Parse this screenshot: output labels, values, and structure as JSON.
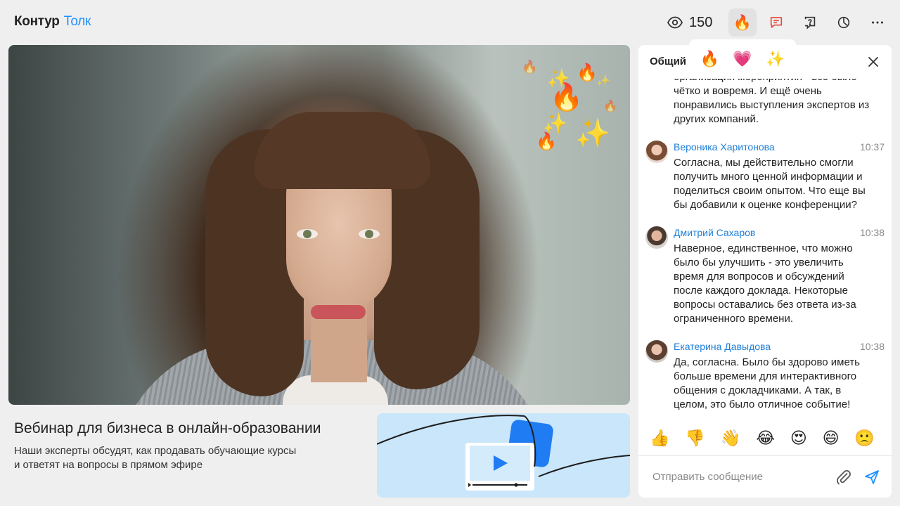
{
  "header": {
    "brand": "Контур",
    "product": "Толк",
    "viewers_count": "150"
  },
  "toolbar": {
    "reaction_icon": "fire-emoji",
    "chat_icon": "chat-icon",
    "question_icon": "question-icon",
    "poll_icon": "pie-chart-icon",
    "more_icon": "more-dots-icon"
  },
  "reaction_popup": [
    "🔥",
    "💗",
    "✨"
  ],
  "webinar": {
    "title": "Вебинар для бизнеса в онлайн-образовании",
    "description_line1": "Наши эксперты обсудят, как продавать обучающие курсы",
    "description_line2": "и ответят на вопросы в прямом эфире"
  },
  "chat": {
    "tab_label": "Общий",
    "continued_lines": [
      "организация мероприятия - всё было",
      "чётко и вовремя. И ещё очень",
      "понравились выступления экспертов из",
      "других компаний."
    ],
    "messages": [
      {
        "author": "Вероника Харитонова",
        "time": "10:37",
        "lines": [
          "Согласна, мы действительно смогли",
          "получить много ценной информации и",
          "поделиться своим опытом. Что еще вы",
          "бы добавили к оценке конференции?"
        ]
      },
      {
        "author": "Дмитрий Сахаров",
        "time": "10:38",
        "lines": [
          "Наверное, единственное, что можно",
          "было бы улучшить - это увеличить",
          "время для вопросов и обсуждений",
          "после каждого доклада. Некоторые",
          "вопросы оставались без ответа из-за",
          "ограниченного времени."
        ]
      },
      {
        "author": "Екатерина Давыдова",
        "time": "10:38",
        "lines": [
          "Да, согласна. Было бы здорово иметь",
          "больше времени для интерактивного",
          "общения с докладчиками. А так, в",
          "целом, это было отличное событие!"
        ]
      }
    ],
    "quick_reactions": [
      "👍",
      "👎",
      "👋",
      "😂",
      "😍",
      "😄",
      "🙁"
    ],
    "input_placeholder": "Отправить сообщение"
  },
  "colors": {
    "accent": "#2291ff",
    "author_name": "#1f80d8",
    "page_background": "#efefef"
  }
}
